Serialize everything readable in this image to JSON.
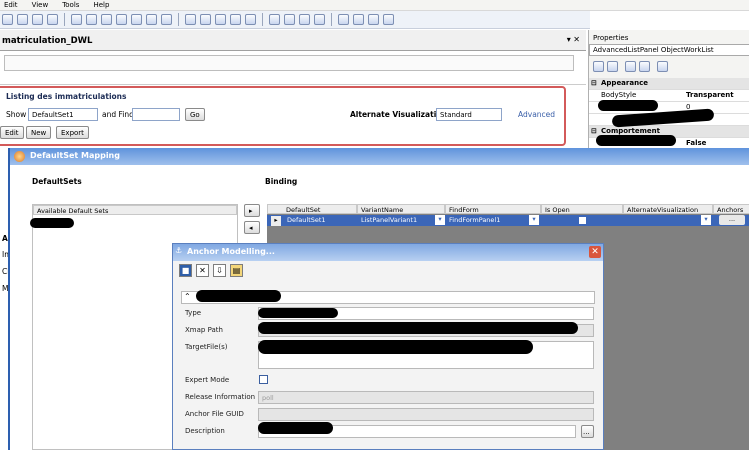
{
  "menu": [
    "Edit",
    "View",
    "Tools",
    "Help"
  ],
  "document": {
    "title": "matriculation_DWL",
    "controls": "▾ ✕"
  },
  "listing": {
    "title": "Listing des immatriculations",
    "show_label": "Show",
    "show_value": "DefaultSet1",
    "find_label": "and Find",
    "go_label": "Go",
    "alt_vis_label": "Alternate Visualization",
    "alt_vis_value": "Standard",
    "advanced_link": "Advanced",
    "edit_label": "Edit",
    "new_label": "New",
    "export_label": "Export"
  },
  "left_labels": [
    "Ap",
    "Im",
    "Ch",
    "Me"
  ],
  "properties": {
    "title": "Properties",
    "object": "AdvancedListPanel ObjectWorkList",
    "section_appearance": "Appearance",
    "bodystyle_label": "BodyStyle",
    "bodystyle_value": "Transparent",
    "value_zero": "0",
    "section_behavior": "Comportement",
    "false_value": "False"
  },
  "dsm": {
    "title": "DefaultSet Mapping",
    "defaultsets_label": "DefaultSets",
    "binding_label": "Binding",
    "available_label": "Available Default Sets",
    "columns": [
      "DefaultSet",
      "VariantName",
      "FindForm",
      "Is Open",
      "AlternateVisualization",
      "Anchors"
    ],
    "row": {
      "defaultset": "DefaultSet1",
      "variant": "ListPanelVariant1",
      "findform": "FindFormPanel1",
      "anchors": "..."
    }
  },
  "anchor_modelling": {
    "title": "Anchor Modelling...",
    "fields": {
      "type": "Type",
      "xmap_path": "Xmap Path",
      "target_files": "TargetFile(s)",
      "expert_mode": "Expert Mode",
      "release_information": "Release Information",
      "release_value": "poll",
      "anchor_file_guid": "Anchor File GUID",
      "description": "Description"
    },
    "ellipsis": "..."
  },
  "colors": {
    "title_blue": "#5f93dc",
    "selection_blue": "#3b66b8",
    "listing_border": "#d35a5a"
  }
}
